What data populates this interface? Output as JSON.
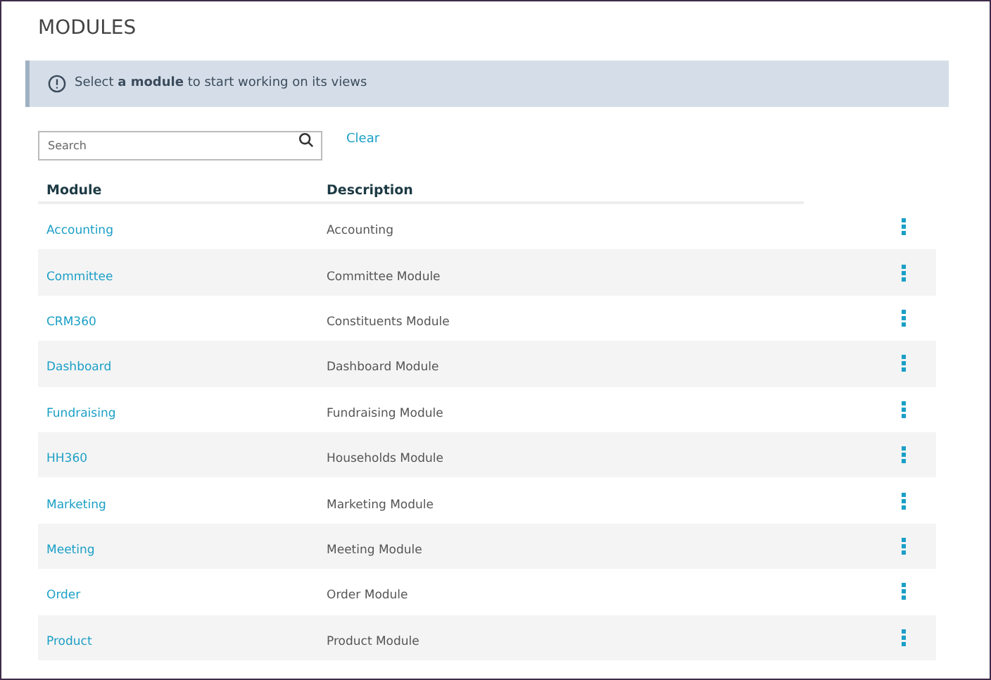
{
  "title": "MODULES",
  "banner": {
    "text": "Select **a module** to start working on its views"
  },
  "search": {
    "placeholder": "Search"
  },
  "clear_link": "Clear",
  "table": {
    "columns": [
      "Module",
      "Description"
    ],
    "rows": [
      {
        "module": "Accounting",
        "description": "Accounting"
      },
      {
        "module": "Committee",
        "description": "Committee Module"
      },
      {
        "module": "CRM360",
        "description": "Constituents Module"
      },
      {
        "module": "Dashboard",
        "description": "Dashboard Module"
      },
      {
        "module": "Fundraising",
        "description": "Fundraising Module"
      },
      {
        "module": "HH360",
        "description": "Households Module"
      },
      {
        "module": "Marketing",
        "description": "Marketing Module"
      },
      {
        "module": "Meeting",
        "description": "Meeting Module"
      },
      {
        "module": "Order",
        "description": "Order Module"
      },
      {
        "module": "Product",
        "description": "Product Module"
      }
    ]
  }
}
